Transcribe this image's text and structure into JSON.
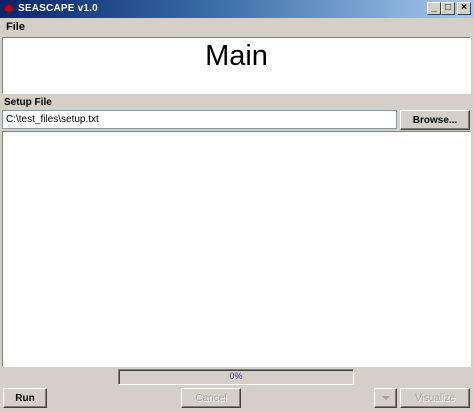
{
  "window": {
    "title": "SEASCAPE v1.0",
    "controls": {
      "minimize": "_",
      "maximize": "□",
      "close": "×"
    }
  },
  "menu": {
    "file_label": "File"
  },
  "banner": {
    "title": "Main"
  },
  "setup": {
    "label": "Setup File",
    "value": "C:\\test_files\\setup.txt",
    "browse_label": "Browse..."
  },
  "progress": {
    "text": "0%",
    "value_percent": 0
  },
  "buttons": {
    "run_label": "Run",
    "cancel_label": "Cancel",
    "visualize_label": "Visualize"
  },
  "icons": {
    "app_icon": "maple-leaf-icon",
    "dropdown_icon": "chevron-down-icon"
  },
  "colors": {
    "titlebar_start": "#0a246a",
    "titlebar_end": "#a6caf0",
    "window_bg": "#d4d0c8",
    "app_icon": "#cc0000"
  }
}
